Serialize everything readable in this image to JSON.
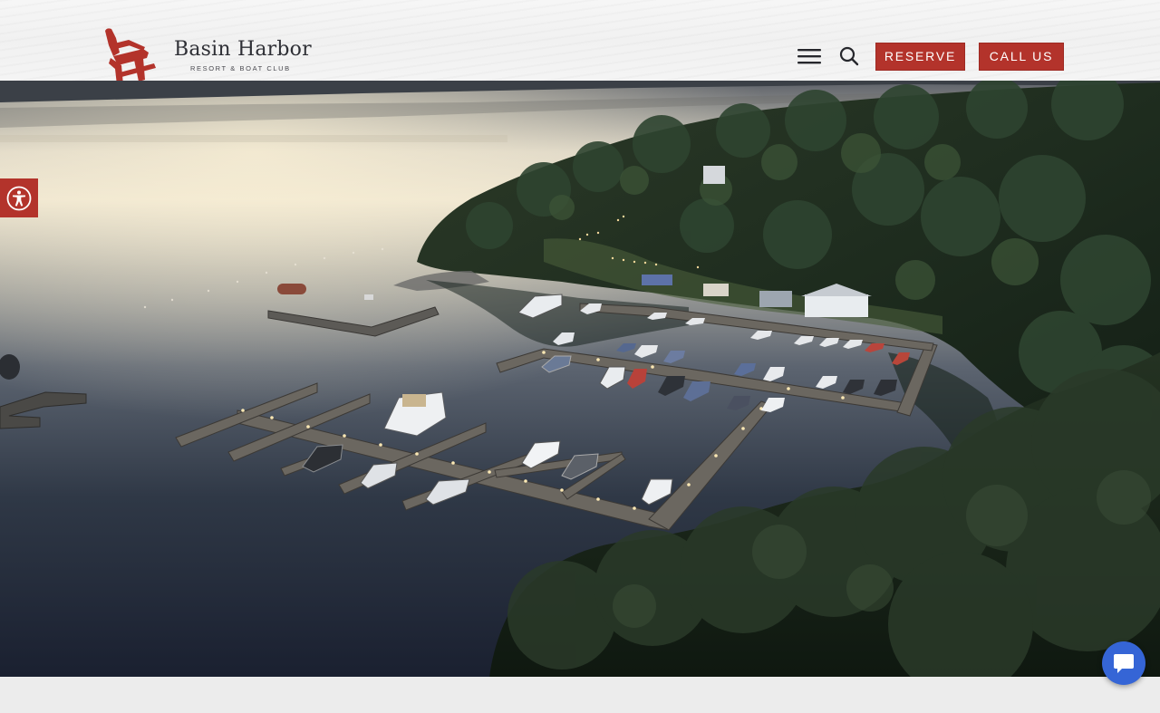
{
  "header": {
    "brand_name": "Basin Harbor",
    "brand_tagline": "RESORT & BOAT CLUB",
    "menu_icon": "hamburger-menu-icon",
    "search_icon": "search-icon",
    "reserve_label": "RESERVE",
    "call_label": "CALL US",
    "button_color": "#b3332b"
  },
  "hero": {
    "description_icon": "aerial-marina-photo",
    "accessibility_icon": "accessibility-icon",
    "chat_icon": "chat-bubble-icon",
    "accent_color": "#b3332b",
    "chat_color": "#3565d6"
  }
}
